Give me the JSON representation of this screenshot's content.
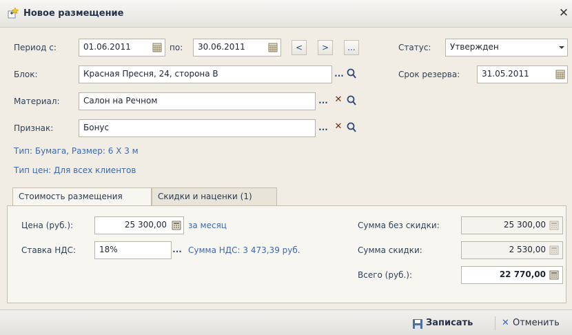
{
  "window": {
    "title": "Новое размещение",
    "close_glyph": "✕"
  },
  "period": {
    "from_label": "Период с:",
    "from_value": "01.06.2011",
    "to_label": "по:",
    "to_value": "30.06.2011",
    "prev": "<",
    "next": ">",
    "more": "..."
  },
  "status": {
    "label": "Статус:",
    "value": "Утвержден"
  },
  "block": {
    "label": "Блок:",
    "value": "Красная Пресня, 24, сторона В"
  },
  "reserve": {
    "label": "Срок резерва:",
    "value": "31.05.2011"
  },
  "material": {
    "label": "Материал:",
    "value": "Салон на Речном"
  },
  "sign": {
    "label": "Признак:",
    "value": "Бонус"
  },
  "info": {
    "type_line": "Тип: Бумага, Размер: 6 X 3 м",
    "price_type_line": "Тип цен: Для всех клиентов"
  },
  "tabs": [
    {
      "label": "Стоимость размещения",
      "active": true
    },
    {
      "label": "Скидки и наценки (1)",
      "active": false
    }
  ],
  "cost": {
    "price_label": "Цена (руб.):",
    "price_value": "25 300,00",
    "per_month": "за месяц",
    "vat_label": "Ставка НДС:",
    "vat_value": "18%",
    "vat_sum": "Сумма НДС: 3 473,39 руб.",
    "no_discount_label": "Сумма без скидки:",
    "no_discount_value": "25 300,00",
    "discount_label": "Сумма скидки:",
    "discount_value": "2 530,00",
    "total_label": "Всего (руб.):",
    "total_value": "22 770,00"
  },
  "footer": {
    "save_label": "Записать",
    "cancel_label": "Отменить"
  },
  "icons": {
    "calendar": "calendar-icon",
    "search": "search-icon",
    "clear": "clear-icon",
    "calculator": "calculator-icon",
    "save": "save-icon",
    "cancel": "cancel-icon",
    "new": "new-placement-icon"
  },
  "colors": {
    "link": "#3d68b0",
    "background": "#f1ede4",
    "clear": "#7a2a10"
  }
}
